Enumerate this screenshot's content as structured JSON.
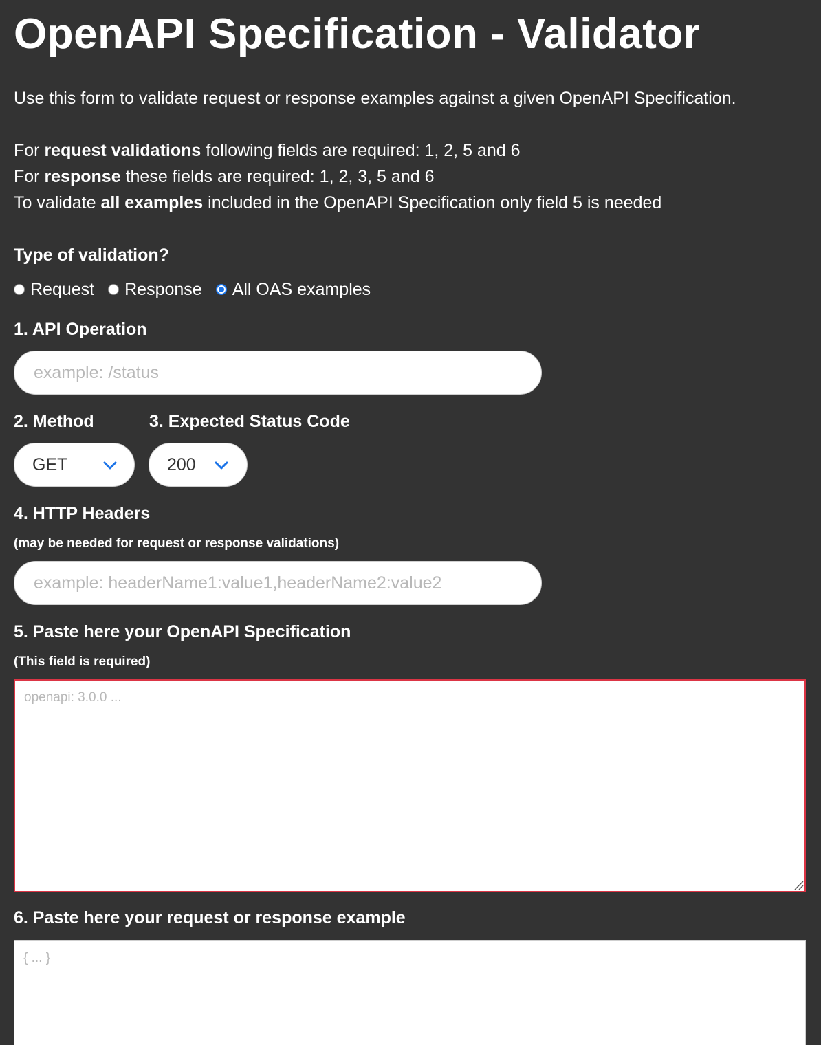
{
  "title": "OpenAPI Specification - Validator",
  "intro": "Use this form to validate request or response examples against a given OpenAPI Specification.",
  "requirements": {
    "request": {
      "prefix": "For ",
      "bold": "request validations",
      "rest": " following fields are required: 1, 2, 5 and 6"
    },
    "response": {
      "prefix": "For ",
      "bold": "response",
      "rest": " these fields are required: 1, 2, 3, 5 and 6"
    },
    "all": {
      "prefix": "To validate ",
      "bold": "all examples",
      "rest": " included in the OpenAPI Specification only field 5 is needed"
    }
  },
  "validation_type": {
    "label": "Type of validation?",
    "options": [
      {
        "label": "Request",
        "checked": false
      },
      {
        "label": "Response",
        "checked": false
      },
      {
        "label": "All OAS examples",
        "checked": true
      }
    ]
  },
  "api_operation": {
    "label": "1. API Operation",
    "placeholder": "example: /status",
    "value": ""
  },
  "method": {
    "label": "2. Method",
    "selected": "GET"
  },
  "status_code": {
    "label": "3. Expected Status Code",
    "selected": "200"
  },
  "headers": {
    "label": "4. HTTP Headers",
    "note": "(may be needed for request or response validations)",
    "placeholder": "example: headerName1:value1,headerName2:value2",
    "value": ""
  },
  "spec": {
    "label": "5. Paste here your OpenAPI Specification",
    "note": "(This field is required)",
    "placeholder": "openapi: 3.0.0 ...",
    "value": ""
  },
  "example": {
    "label": "6. Paste here your request or response example",
    "placeholder": "{ ... }",
    "value": ""
  },
  "colors": {
    "background": "#333333",
    "accent": "#1a73e8",
    "error_border": "#dc3545"
  }
}
